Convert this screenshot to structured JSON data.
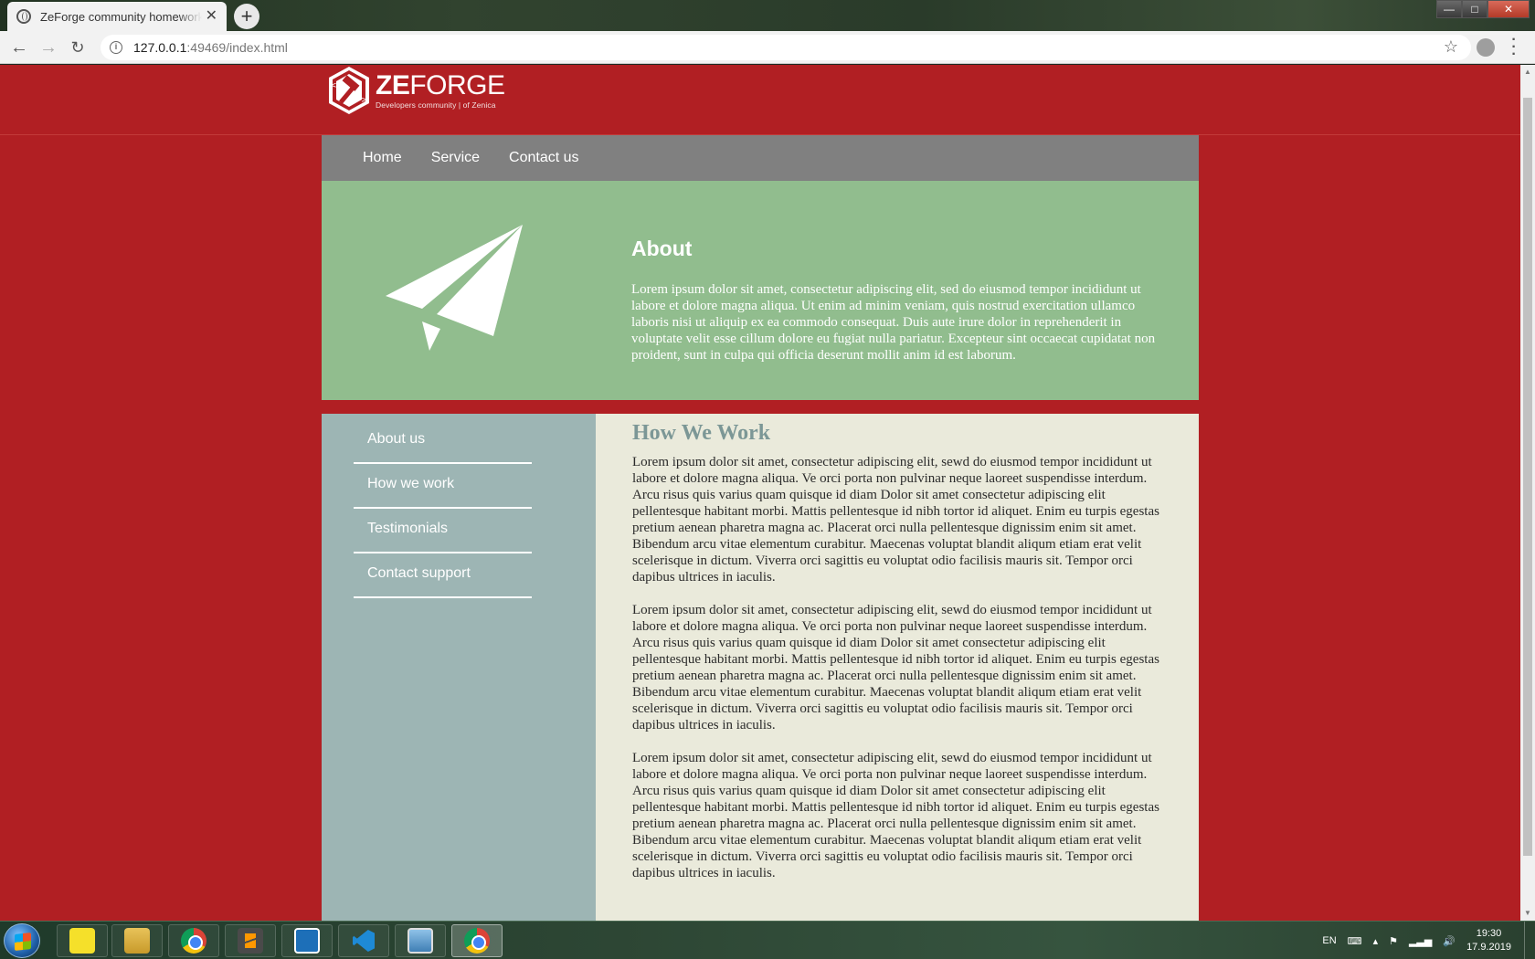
{
  "browser": {
    "tab_title": "ZeForge community homework r",
    "tab_close": "✕",
    "new_tab": "+",
    "url_host": "127.0.0.1",
    "url_rest": ":49469/index.html",
    "window_controls": {
      "minimize": "—",
      "maximize": "□",
      "close": "✕"
    }
  },
  "site": {
    "logo": {
      "brand_bold": "ZE",
      "brand_rest": "FORGE",
      "tagline": "Developers community | of Zenica"
    },
    "nav": [
      "Home",
      "Service",
      "Contact us"
    ],
    "hero": {
      "title": "About",
      "text": "Lorem ipsum dolor sit amet, consectetur adipiscing elit, sed do eiusmod tempor incididunt ut labore et dolore magna aliqua. Ut enim ad minim veniam, quis nostrud exercitation ullamco laboris nisi ut aliquip ex ea commodo consequat. Duis aute irure dolor in reprehenderit in voluptate velit esse cillum dolore eu fugiat nulla pariatur. Excepteur sint occaecat cupidatat non proident, sunt in culpa qui officia deserunt mollit anim id est laborum."
    },
    "sidebar": [
      "About us",
      "How we work",
      "Testimonials",
      "Contact support"
    ],
    "main": {
      "title": "How We Work",
      "paragraphs": [
        "Lorem ipsum dolor sit amet, consectetur adipiscing elit, sewd do eiusmod tempor incididunt ut labore et dolore magna aliqua. Ve orci porta non pulvinar neque laoreet suspendisse interdum. Arcu risus quis varius quam quisque id diam Dolor sit amet consectetur adipiscing elit pellentesque habitant morbi. Mattis pellentesque id nibh tortor id aliquet. Enim eu turpis egestas pretium aenean pharetra magna ac. Placerat orci nulla pellentesque dignissim enim sit amet. Bibendum arcu vitae elementum curabitur. Maecenas voluptat blandit aliqum etiam erat velit scelerisque in dictum. Viverra orci sagittis eu voluptat odio facilisis mauris sit. Tempor orci dapibus ultrices in iaculis.",
        "Lorem ipsum dolor sit amet, consectetur adipiscing elit, sewd do eiusmod tempor incididunt ut labore et dolore magna aliqua. Ve orci porta non pulvinar neque laoreet suspendisse interdum. Arcu risus quis varius quam quisque id diam Dolor sit amet consectetur adipiscing elit pellentesque habitant morbi. Mattis pellentesque id nibh tortor id aliquet. Enim eu turpis egestas pretium aenean pharetra magna ac. Placerat orci nulla pellentesque dignissim enim sit amet. Bibendum arcu vitae elementum curabitur. Maecenas voluptat blandit aliqum etiam erat velit scelerisque in dictum. Viverra orci sagittis eu voluptat odio facilisis mauris sit. Tempor orci dapibus ultrices in iaculis.",
        "Lorem ipsum dolor sit amet, consectetur adipiscing elit, sewd do eiusmod tempor incididunt ut labore et dolore magna aliqua. Ve orci porta non pulvinar neque laoreet suspendisse interdum. Arcu risus quis varius quam quisque id diam Dolor sit amet consectetur adipiscing elit pellentesque habitant morbi. Mattis pellentesque id nibh tortor id aliquet. Enim eu turpis egestas pretium aenean pharetra magna ac. Placerat orci nulla pellentesque dignissim enim sit amet. Bibendum arcu vitae elementum curabitur. Maecenas voluptat blandit aliqum etiam erat velit scelerisque in dictum. Viverra orci sagittis eu voluptat odio facilisis mauris sit. Tempor orci dapibus ultrices in iaculis."
      ]
    }
  },
  "taskbar": {
    "apps": [
      "sticky-notes-icon",
      "file-explorer-icon",
      "chrome-icon",
      "sublime-text-icon",
      "brackets-icon",
      "vscode-icon",
      "photos-icon",
      "chrome-icon"
    ],
    "language": "EN",
    "time": "19:30",
    "date": "17.9.2019"
  },
  "colors": {
    "page_bg": "#b11f23",
    "nav_bg": "#808080",
    "hero_bg": "#91bd8e",
    "sidebar_bg": "#9db5b4",
    "main_bg": "#eaeadb",
    "main_title": "#7c9796"
  }
}
